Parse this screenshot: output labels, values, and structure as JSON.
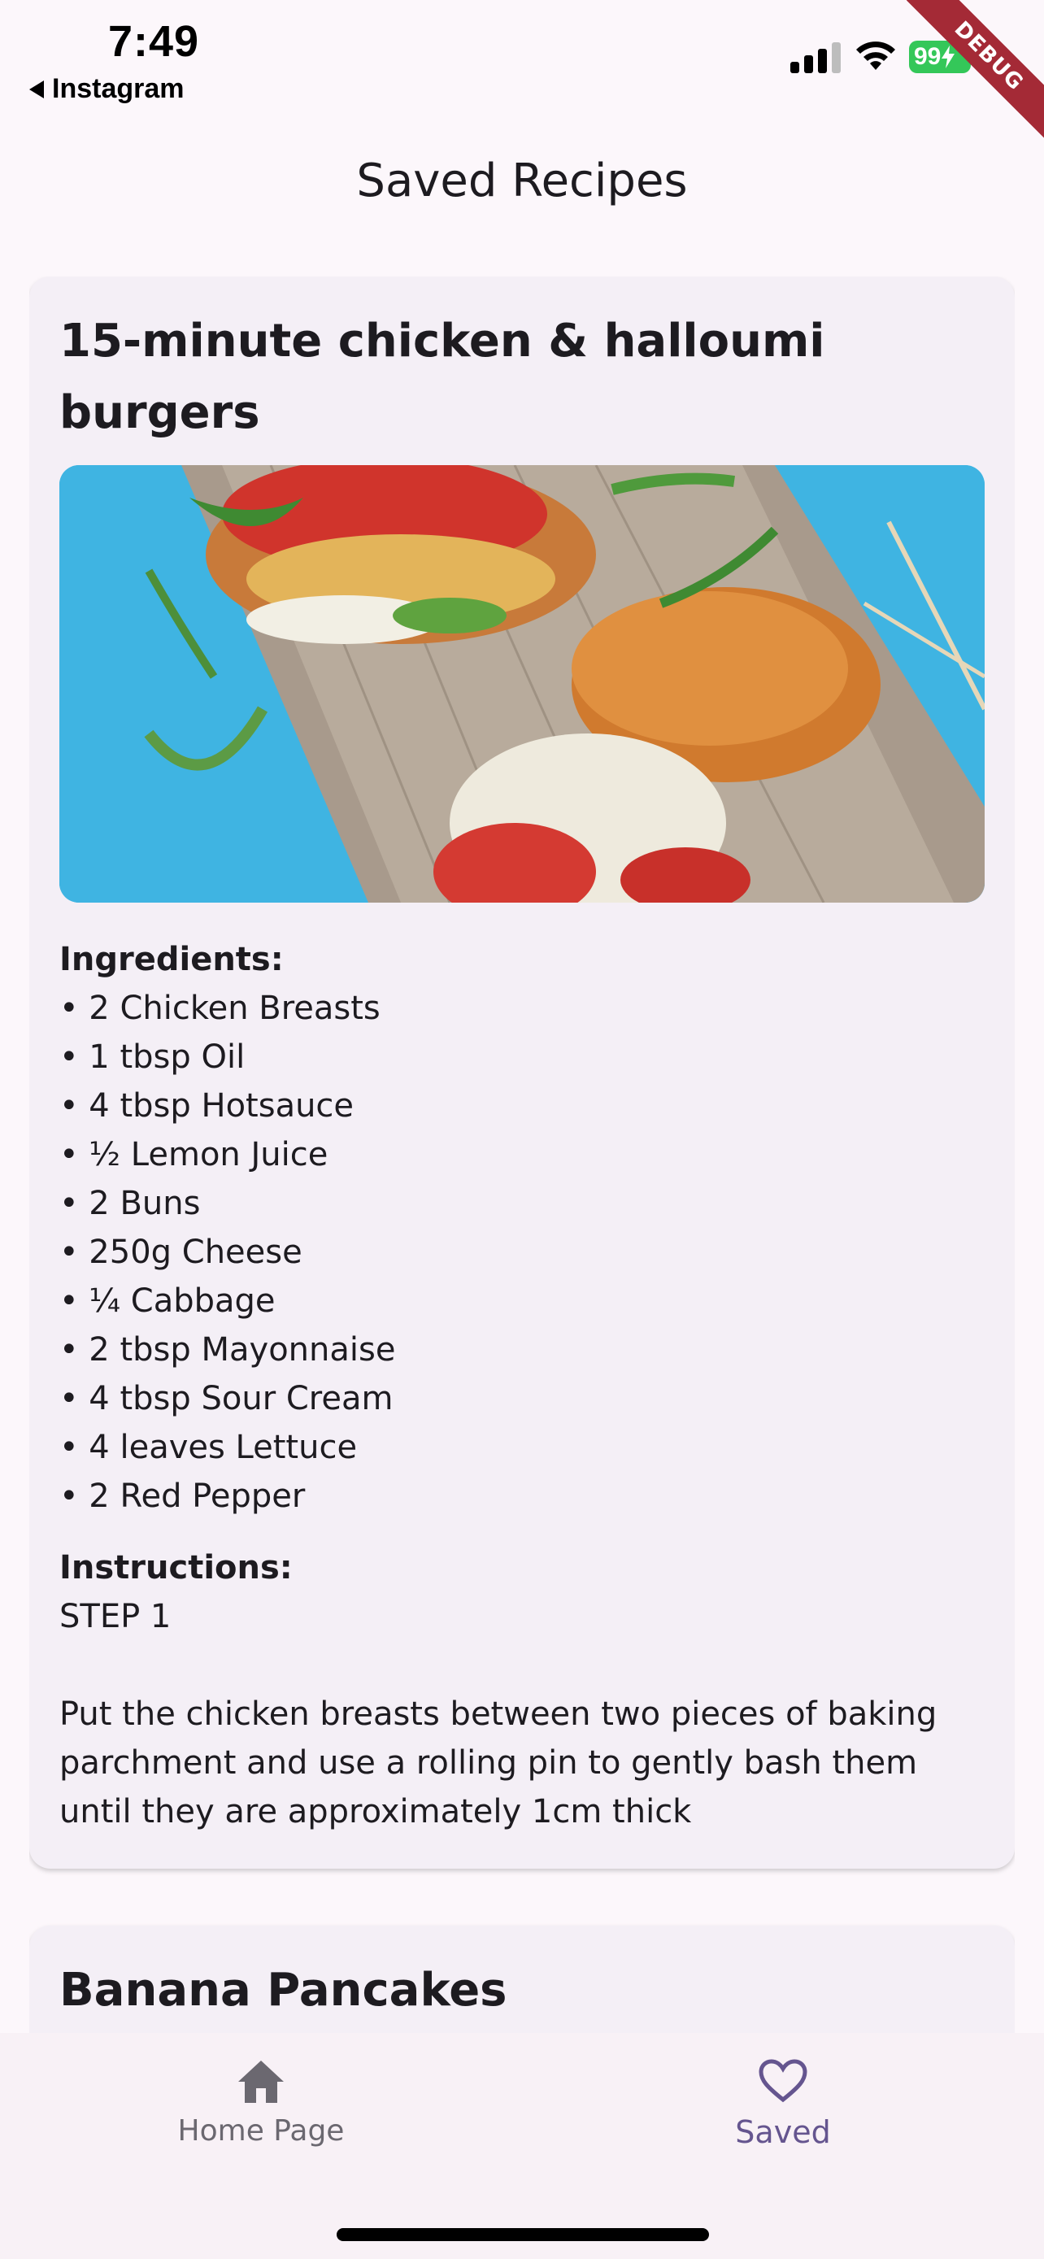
{
  "status_bar": {
    "time": "7:49",
    "back_app": "Instagram",
    "battery": "99",
    "debug_label": "DEBUG"
  },
  "app_bar": {
    "title": "Saved Recipes"
  },
  "recipes": [
    {
      "title": "15-minute chicken & halloumi burgers",
      "ingredients_label": "Ingredients:",
      "ingredients": [
        "• 2 Chicken Breasts",
        "• 1 tbsp Oil",
        "• 4 tbsp Hotsauce",
        "• ½ Lemon Juice",
        "• 2 Buns",
        "• 250g Cheese",
        "• ¼ Cabbage",
        "• 2 tbsp Mayonnaise",
        "• 4 tbsp Sour Cream",
        "• 4 leaves Lettuce",
        "• 2 Red Pepper"
      ],
      "instructions_label": "Instructions:",
      "step_label": "STEP 1",
      "step_text": "Put the chicken breasts between two pieces of baking parchment and use a rolling pin to gently bash them until they are approximately 1cm thick"
    },
    {
      "title": "Banana Pancakes"
    }
  ],
  "bottom_nav": {
    "items": [
      {
        "label": "Home Page",
        "icon": "home-icon",
        "selected": false
      },
      {
        "label": "Saved",
        "icon": "heart-outline-icon",
        "selected": true
      }
    ],
    "colors": {
      "selected": "#65558f",
      "unselected": "#6b6870"
    }
  }
}
